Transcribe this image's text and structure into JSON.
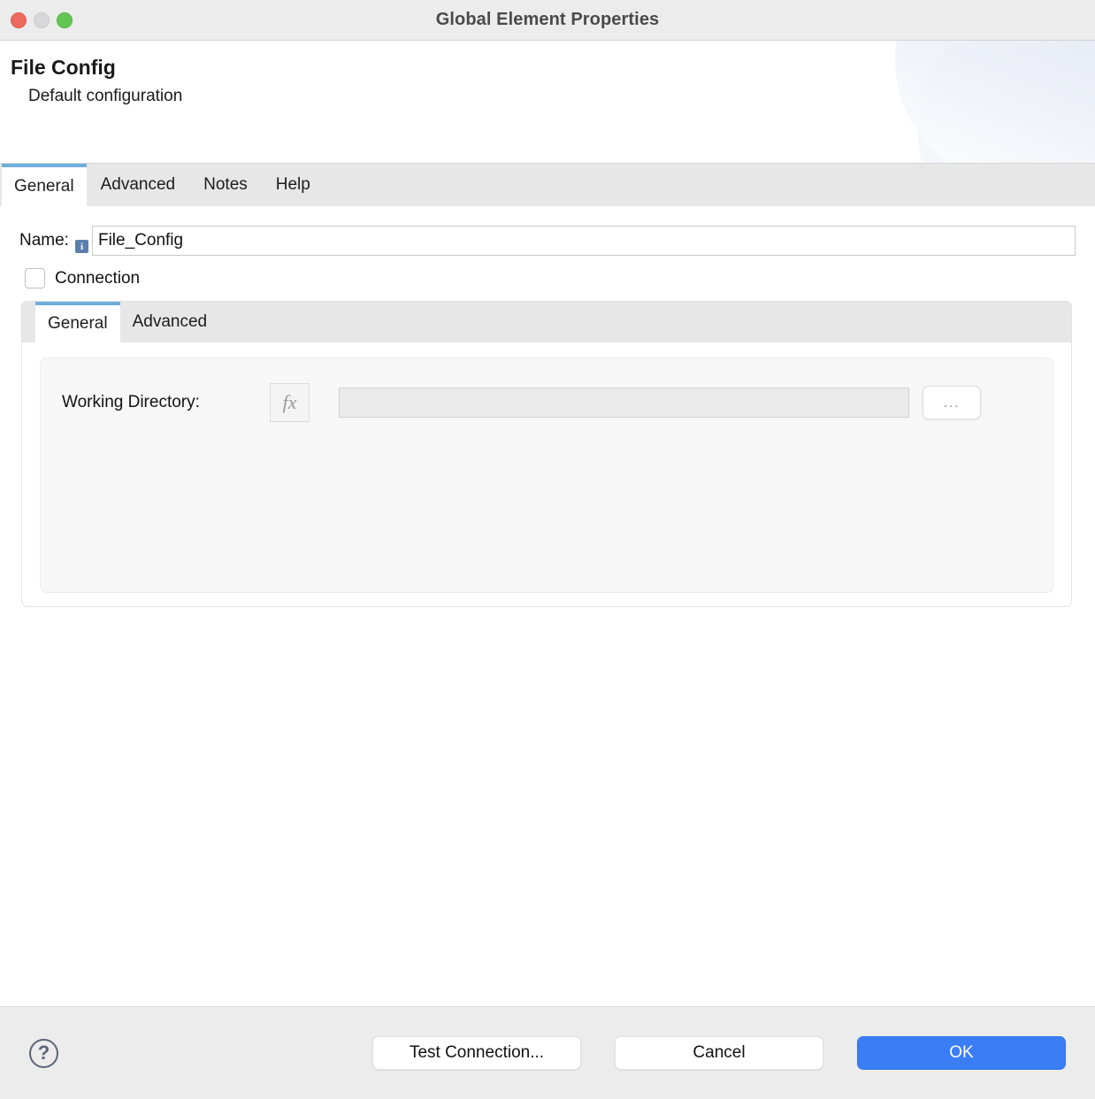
{
  "window": {
    "title": "Global Element Properties",
    "traffic_lights": [
      {
        "name": "close",
        "color": "#ec6a5e"
      },
      {
        "name": "minimize",
        "color": "#d8d8da"
      },
      {
        "name": "zoom",
        "color": "#62c554"
      }
    ]
  },
  "header": {
    "title": "File Config",
    "subtitle": "Default configuration"
  },
  "outer_tabs": [
    {
      "label": "General",
      "active": true
    },
    {
      "label": "Advanced",
      "active": false
    },
    {
      "label": "Notes",
      "active": false
    },
    {
      "label": "Help",
      "active": false
    }
  ],
  "general_tab": {
    "name_field": {
      "label": "Name:",
      "value": "File_Config",
      "placeholder": "",
      "info_icon": "info-icon",
      "info_glyph": "i"
    },
    "connection_checkbox": {
      "label": "Connection",
      "checked": false
    },
    "inner_tabs": [
      {
        "label": "General",
        "active": true
      },
      {
        "label": "Advanced",
        "active": false
      }
    ],
    "working_directory": {
      "label": "Working Directory:",
      "fx_button_label": "fx",
      "value": "",
      "placeholder": "",
      "browse_button_label": "..."
    }
  },
  "footer": {
    "help_icon": "help-icon",
    "help_glyph": "?",
    "test_connection_label": "Test Connection...",
    "cancel_label": "Cancel",
    "ok_label": "OK"
  },
  "colors": {
    "accent_blue": "#3b7df5",
    "tab_indicator": "#6eaedd",
    "info_badge": "#5b7fad",
    "window_chrome": "#ececec",
    "tabstrip": "#e7e7e8"
  }
}
